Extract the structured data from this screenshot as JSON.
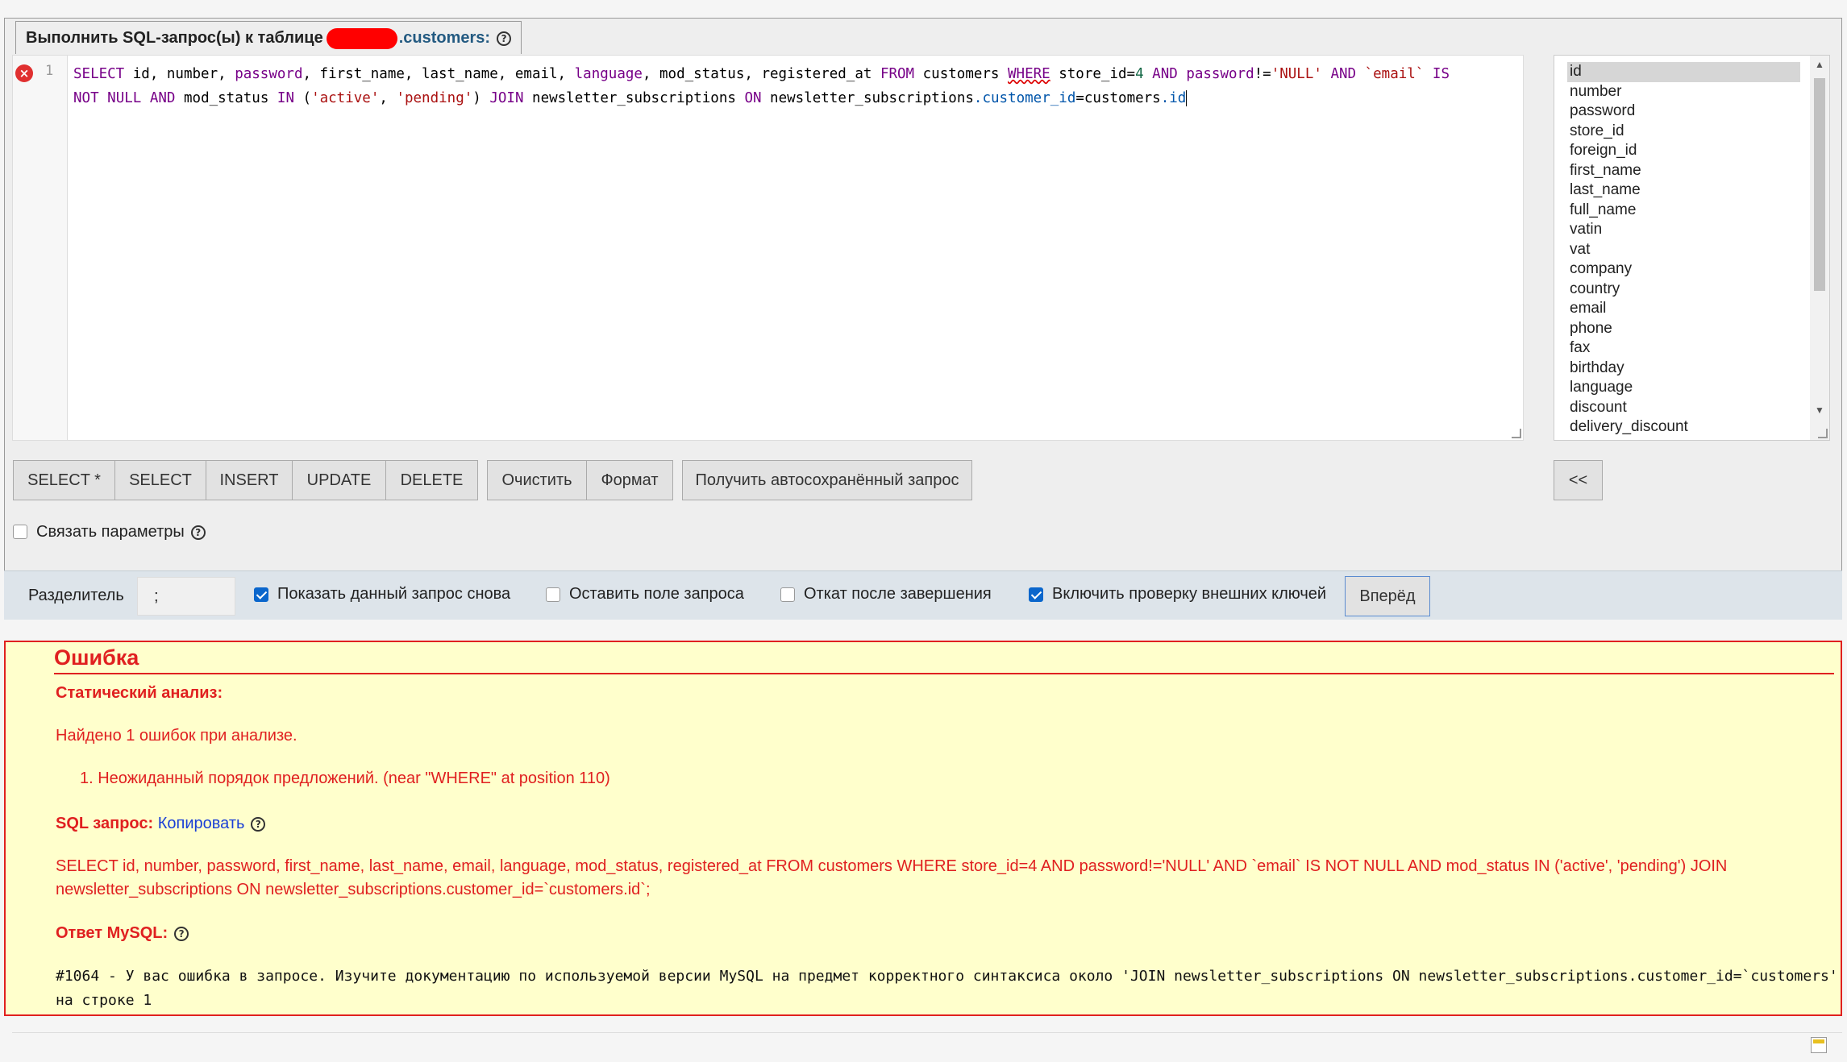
{
  "header": {
    "title_prefix": "Выполнить SQL-запрос(ы) к таблице",
    "table_suffix": ".customers:"
  },
  "editor": {
    "line_number": "1",
    "query_text": "SELECT id, number, password, first_name, last_name, email, language, mod_status, registered_at FROM customers WHERE store_id=4 AND password!='NULL' AND `email` IS NOT NULL AND mod_status IN ('active', 'pending') JOIN newsletter_subscriptions ON newsletter_subscriptions.customer_id=customers.id"
  },
  "columns": [
    "id",
    "number",
    "password",
    "store_id",
    "foreign_id",
    "first_name",
    "last_name",
    "full_name",
    "vatin",
    "vat",
    "company",
    "country",
    "email",
    "phone",
    "fax",
    "birthday",
    "language",
    "discount",
    "delivery_discount"
  ],
  "buttons": {
    "select_star": "SELECT *",
    "select": "SELECT",
    "insert": "INSERT",
    "update": "UPDATE",
    "delete": "DELETE",
    "clear": "Очистить",
    "format": "Формат",
    "autosaved": "Получить автосохранённый запрос",
    "insert_col": "<<",
    "go": "Вперёд"
  },
  "options": {
    "bind_params": "Связать параметры",
    "delimiter_label": "Разделитель",
    "delimiter_value": ";",
    "show_query_again": "Показать данный запрос снова",
    "keep_query_box": "Оставить поле запроса",
    "rollback": "Откат после завершения",
    "foreign_keys": "Включить проверку внешних ключей"
  },
  "error": {
    "title": "Ошибка",
    "static_analysis": "Статический анализ:",
    "found": "Найдено 1 ошибок при анализе.",
    "item": "1. Неожиданный порядок предложений. (near \"WHERE\" at position 110)",
    "sql_label": "SQL запрос:",
    "copy_link": "Копировать",
    "sql_line1": "SELECT id, number, password, first_name, last_name, email, language, mod_status, registered_at FROM customers WHERE store_id=4 AND password!='NULL' AND `email` IS NOT NULL AND mod_status IN ('active', 'pending') JOIN",
    "sql_line2": "newsletter_subscriptions ON newsletter_subscriptions.customer_id=`customers.id`;",
    "mysql_label": "Ответ MySQL:",
    "mysql_line1": "#1064 - У вас ошибка в запросе. Изучите документацию по используемой версии MySQL на предмет корректного синтаксиса около 'JOIN newsletter_subscriptions ON newsletter_subscriptions.customer_id=`customers'",
    "mysql_line2": "на строке 1"
  }
}
